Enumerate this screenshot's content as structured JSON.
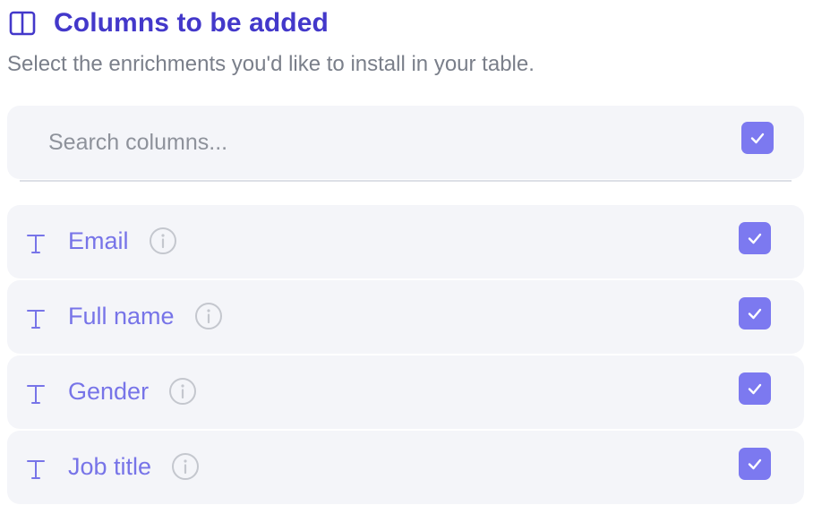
{
  "header": {
    "title": "Columns to be added",
    "icon": "columns-icon"
  },
  "subtitle": "Select the enrichments you'd like to install in your table.",
  "search": {
    "placeholder": "Search columns...",
    "value": "",
    "select_all_checked": true
  },
  "columns": [
    {
      "label": "Email",
      "type_icon": "text-type-icon",
      "checked": true
    },
    {
      "label": "Full name",
      "type_icon": "text-type-icon",
      "checked": true
    },
    {
      "label": "Gender",
      "type_icon": "text-type-icon",
      "checked": true
    },
    {
      "label": "Job title",
      "type_icon": "text-type-icon",
      "checked": true
    }
  ],
  "colors": {
    "accent": "#7c79f0",
    "title": "#4338ca",
    "label": "#7774e8",
    "row_background": "#f4f5f9",
    "muted_text": "#7a7f8a"
  }
}
